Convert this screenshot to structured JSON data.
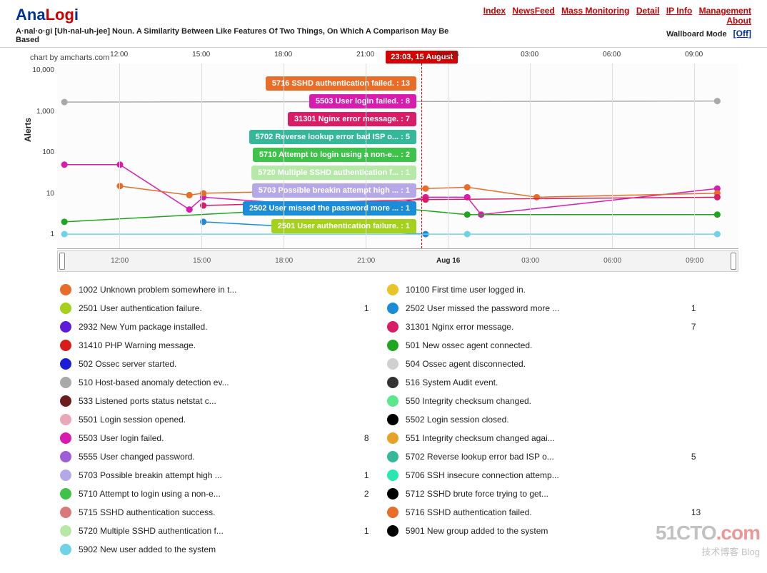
{
  "brand": {
    "part1": "Ana",
    "part2": "Log",
    "part3": "i"
  },
  "tagline": "A·nal·o·gi [Uh-nal-uh-jee] Noun. A Similarity Between Like Features Of Two Things, On Which A Comparison May Be Based",
  "nav": {
    "index": "Index",
    "newsfeed": "NewsFeed",
    "mass": "Mass Monitoring",
    "detail": "Detail",
    "ipinfo": "IP Info",
    "mgmt": "Management",
    "about": "About"
  },
  "wallboard": {
    "label": "Wallboard Mode ",
    "state": "[Off]"
  },
  "credit": "chart by amcharts.com",
  "ylabel": "Alerts",
  "cursor_time": "23:03, 15 August",
  "tooltips": [
    {
      "text": "5716 SSHD authentication failed. : 13",
      "color": "#e86d28"
    },
    {
      "text": "5503 User login failed. : 8",
      "color": "#d81cb0"
    },
    {
      "text": "31301 Nginx error message. : 7",
      "color": "#d81c66"
    },
    {
      "text": "5702 Reverse lookup error bad ISP o... : 5",
      "color": "#35b79a"
    },
    {
      "text": "5710 Attempt to login using a non-e... : 2",
      "color": "#3fc24a"
    },
    {
      "text": "5720 Multiple SSHD authentication f... : 1",
      "color": "#b6e9a8"
    },
    {
      "text": "5703 Possible breakin attempt high ... : 1",
      "color": "#b5a8e9"
    },
    {
      "text": "2502 User missed the password more ... : 1",
      "color": "#1a8cd8"
    },
    {
      "text": "2501 User authentication failure. : 1",
      "color": "#a5d11c"
    }
  ],
  "chart_data": {
    "type": "line",
    "xlabel": "",
    "ylabel": "Alerts",
    "yscale": "log",
    "ylim": [
      1,
      10000
    ],
    "x_ticks": [
      "12:00",
      "15:00",
      "18:00",
      "21:00",
      "Aug 16",
      "03:00",
      "06:00",
      "09:00"
    ],
    "annotations": [
      {
        "x": "23:03, 15 August"
      }
    ],
    "series": [
      {
        "name": "510 Host-based anomaly detection ev...",
        "color": "#a9a9a9",
        "x": [
          "10:00",
          "09:30"
        ],
        "y": [
          1700,
          1800
        ]
      },
      {
        "name": "5503 User login failed.",
        "color": "#d81cb0",
        "x": [
          "10:00",
          "12:00",
          "14:30",
          "15:00",
          "21:00",
          "23:00",
          "00:30",
          "01:00",
          "09:30"
        ],
        "y": [
          50,
          50,
          4,
          8,
          4,
          8,
          8,
          3,
          13
        ]
      },
      {
        "name": "5716 SSHD authentication failed.",
        "color": "#e86d28",
        "x": [
          "12:00",
          "14:30",
          "15:00",
          "23:00",
          "00:30",
          "03:00",
          "09:30"
        ],
        "y": [
          15,
          9,
          10,
          13,
          14,
          8,
          10
        ]
      },
      {
        "name": "501 New ossec agent connected.",
        "color": "#1fa51f",
        "x": [
          "10:00",
          "21:00",
          "00:30",
          "09:30"
        ],
        "y": [
          2,
          5,
          3,
          3
        ]
      },
      {
        "name": "31301 Nginx error message.",
        "color": "#d81c66",
        "x": [
          "15:00",
          "23:00",
          "09:30"
        ],
        "y": [
          5,
          7,
          8
        ]
      },
      {
        "name": "2502 User missed the password more ...",
        "color": "#1a8cd8",
        "x": [
          "15:00",
          "23:00"
        ],
        "y": [
          2,
          1
        ]
      },
      {
        "name": "5902 New user added to the system",
        "color": "#6ed3e6",
        "x": [
          "10:00",
          "00:30",
          "09:30"
        ],
        "y": [
          1,
          1,
          1
        ]
      }
    ]
  },
  "legend_left": [
    {
      "color": "#e86d28",
      "label": "1002 Unknown problem somewhere in t...",
      "count": ""
    },
    {
      "color": "#a5d11c",
      "label": "2501 User authentication failure.",
      "count": "1"
    },
    {
      "color": "#5c1cd8",
      "label": "2932 New Yum package installed.",
      "count": ""
    },
    {
      "color": "#d81c1c",
      "label": "31410 PHP Warning message.",
      "count": ""
    },
    {
      "color": "#1c1cd8",
      "label": "502 Ossec server started.",
      "count": ""
    },
    {
      "color": "#a9a9a9",
      "label": "510 Host-based anomaly detection ev...",
      "count": ""
    },
    {
      "color": "#6b1c1c",
      "label": "533 Listened ports status netstat c...",
      "count": ""
    },
    {
      "color": "#e8a8b8",
      "label": "5501 Login session opened.",
      "count": ""
    },
    {
      "color": "#d81cb0",
      "label": "5503 User login failed.",
      "count": "8"
    },
    {
      "color": "#a05cd8",
      "label": "5555 User changed password.",
      "count": ""
    },
    {
      "color": "#b5a8e9",
      "label": "5703 Possible breakin attempt high ...",
      "count": "1"
    },
    {
      "color": "#3fc24a",
      "label": "5710 Attempt to login using a non-e...",
      "count": "2"
    },
    {
      "color": "#d87a7a",
      "label": "5715 SSHD authentication success.",
      "count": ""
    },
    {
      "color": "#b6e9a8",
      "label": "5720 Multiple SSHD authentication f...",
      "count": "1"
    },
    {
      "color": "#6ed3e6",
      "label": "5902 New user added to the system",
      "count": ""
    }
  ],
  "legend_right": [
    {
      "color": "#e8c428",
      "label": "10100 First time user logged in.",
      "count": ""
    },
    {
      "color": "#1a8cd8",
      "label": "2502 User missed the password more ...",
      "count": "1"
    },
    {
      "color": "#d81c66",
      "label": "31301 Nginx error message.",
      "count": "7"
    },
    {
      "color": "#1fa51f",
      "label": "501 New ossec agent connected.",
      "count": ""
    },
    {
      "color": "#d0d0d0",
      "label": "504 Ossec agent disconnected.",
      "count": ""
    },
    {
      "color": "#333333",
      "label": "516 System Audit event.",
      "count": ""
    },
    {
      "color": "#5ce88a",
      "label": "550 Integrity checksum changed.",
      "count": ""
    },
    {
      "color": "#000000",
      "label": "5502 Login session closed.",
      "count": ""
    },
    {
      "color": "#e8a028",
      "label": "551 Integrity checksum changed agai...",
      "count": ""
    },
    {
      "color": "#35b79a",
      "label": "5702 Reverse lookup error bad ISP o...",
      "count": "5"
    },
    {
      "color": "#28e8b0",
      "label": "5706 SSH insecure connection attemp...",
      "count": ""
    },
    {
      "color": "#000000",
      "label": "5712 SSHD brute force trying to get...",
      "count": ""
    },
    {
      "color": "#e86d28",
      "label": "5716 SSHD authentication failed.",
      "count": "13"
    },
    {
      "color": "#000000",
      "label": "5901 New group added to the system",
      "count": ""
    }
  ],
  "watermark": {
    "big1": "51CTO",
    "big2": ".com",
    "sub": "技术博客  Blog"
  }
}
